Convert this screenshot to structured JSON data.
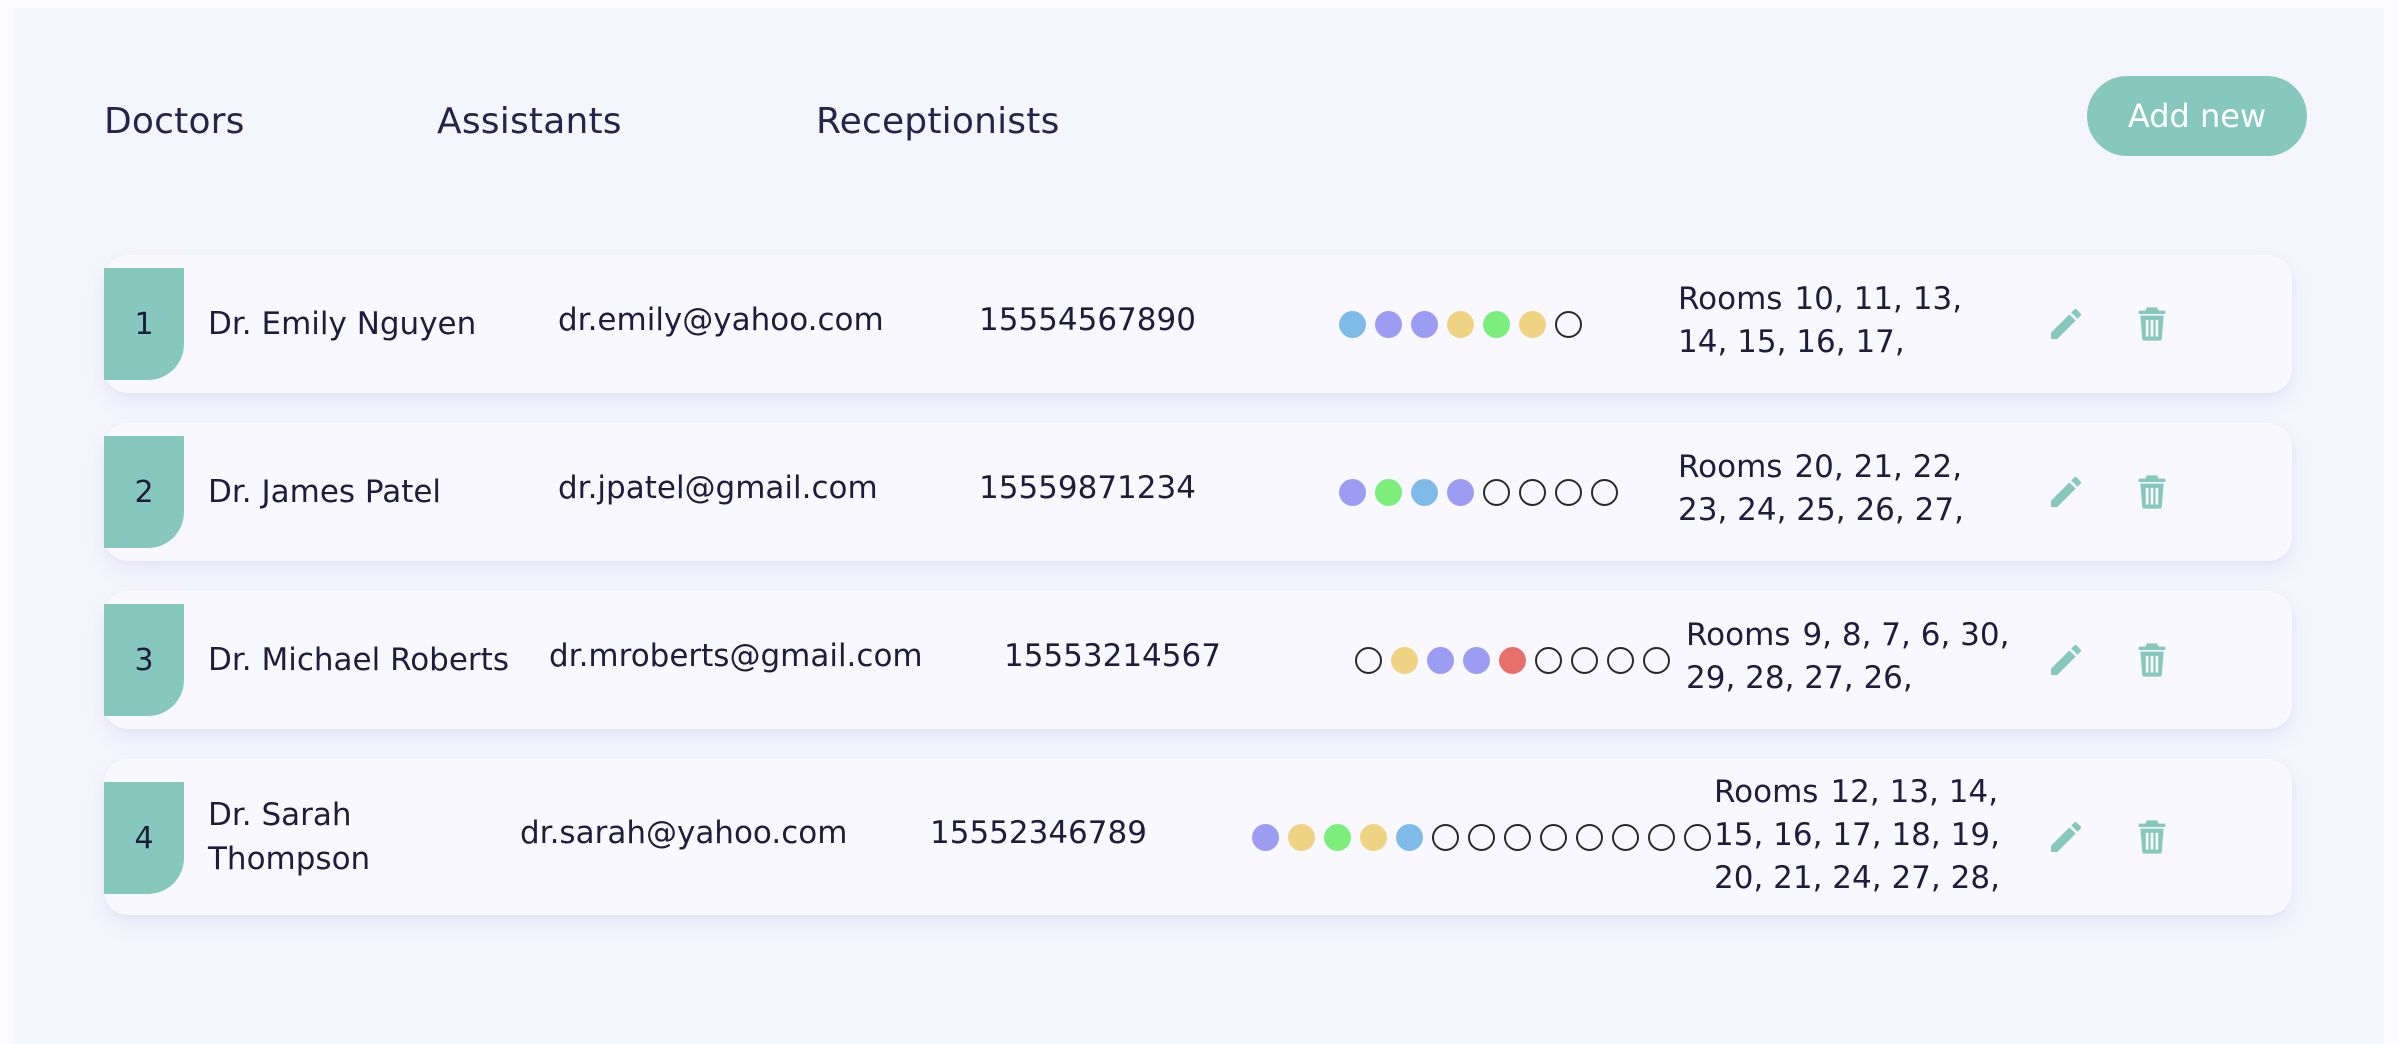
{
  "tabs": [
    {
      "label": "Doctors"
    },
    {
      "label": "Assistants"
    },
    {
      "label": "Receptionists"
    }
  ],
  "add_button": {
    "label": "Add new"
  },
  "accent_color": "#86c8bd",
  "dot_colors": {
    "blue": "#7ebbe9",
    "purple": "#9c9cf2",
    "yellow": "#eed482",
    "green": "#7cee7c",
    "red": "#e8706a"
  },
  "rooms_label": "Rooms",
  "rows": [
    {
      "number": "1",
      "name": "Dr. Emily Nguyen",
      "email": "dr.emily@yahoo.com",
      "phone": "15554567890",
      "dots": [
        "blue",
        "purple",
        "purple",
        "yellow",
        "green",
        "yellow",
        "empty"
      ],
      "rooms": "10, 11, 13, 14, 15, 16, 17,"
    },
    {
      "number": "2",
      "name": "Dr. James Patel",
      "email": "dr.jpatel@gmail.com",
      "phone": "15559871234",
      "dots": [
        "purple",
        "green",
        "blue",
        "purple",
        "empty",
        "empty",
        "empty",
        "empty"
      ],
      "rooms": "20, 21, 22, 23, 24, 25, 26, 27,"
    },
    {
      "number": "3",
      "name": "Dr. Michael Roberts",
      "email": "dr.mroberts@gmail.com",
      "phone": "15553214567",
      "dots": [
        "empty",
        "yellow",
        "purple",
        "purple",
        "red",
        "empty",
        "empty",
        "empty",
        "empty"
      ],
      "rooms": "9, 8, 7, 6, 30, 29, 28, 27, 26,"
    },
    {
      "number": "4",
      "name": "Dr. Sarah Thompson",
      "email": "dr.sarah@yahoo.com",
      "phone": "15552346789",
      "dots": [
        "purple",
        "yellow",
        "green",
        "yellow",
        "blue",
        "empty",
        "empty",
        "empty",
        "empty",
        "empty",
        "empty",
        "empty",
        "empty"
      ],
      "rooms": "12, 13, 14, 15, 16, 17, 18, 19, 20, 21, 24, 27, 28,"
    }
  ],
  "icons": {
    "edit": "pencil-icon",
    "delete": "trash-icon"
  }
}
